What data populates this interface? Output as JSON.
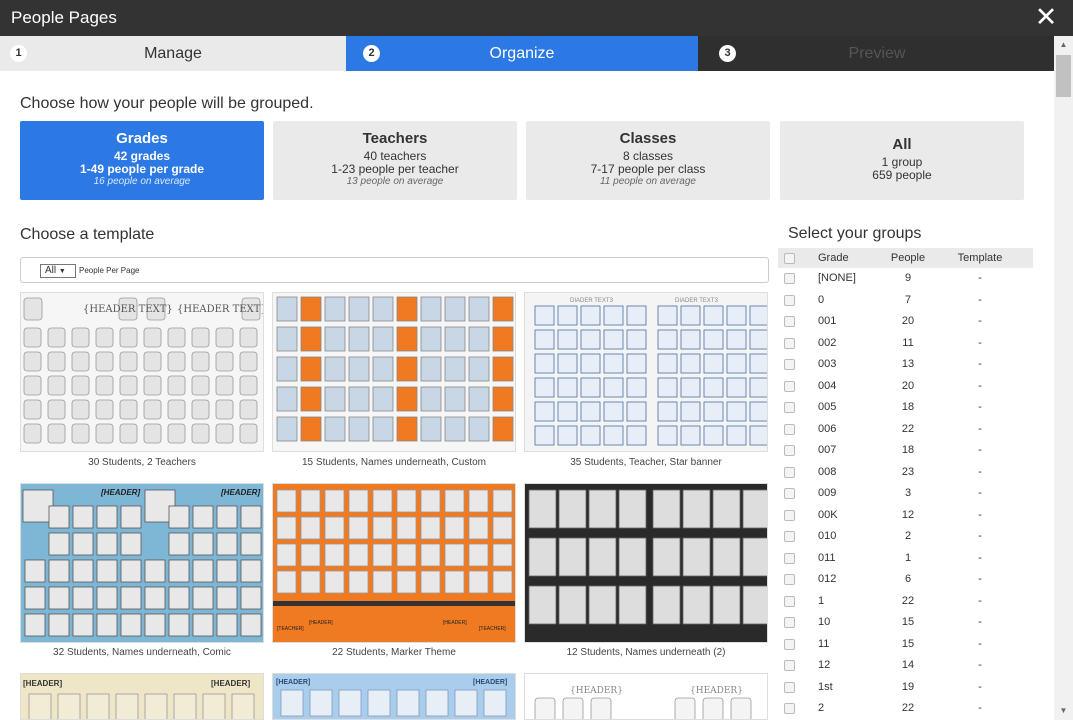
{
  "window": {
    "title": "People Pages",
    "close_icon": "close-icon"
  },
  "steps": [
    {
      "num": "1",
      "label": "Manage"
    },
    {
      "num": "2",
      "label": "Organize"
    },
    {
      "num": "3",
      "label": "Preview"
    }
  ],
  "grouping": {
    "heading": "Choose how your people will be grouped.",
    "options": [
      {
        "title": "Grades",
        "count": "42 grades",
        "range": "1-49 people per grade",
        "avg": "16 people on average"
      },
      {
        "title": "Teachers",
        "count": "40 teachers",
        "range": "1-23 people per teacher",
        "avg": "13 people on average"
      },
      {
        "title": "Classes",
        "count": "8 classes",
        "range": "7-17 people per class",
        "avg": "11 people on average"
      },
      {
        "title": "All",
        "count": "1 group",
        "range": "659 people"
      }
    ]
  },
  "templates": {
    "heading": "Choose a template",
    "filter_value": "All",
    "filter_label": "People Per Page",
    "items": [
      {
        "caption": "30 Students, 2 Teachers",
        "header_text": "{HEADER TEXT}"
      },
      {
        "caption": "15 Students, Names underneath, Custom"
      },
      {
        "caption": "35 Students, Teacher, Star banner",
        "header_text": "DIADER TEXT3"
      },
      {
        "caption": "32 Students, Names underneath, Comic",
        "header_text": "[HEADER]"
      },
      {
        "caption": "22 Students, Marker Theme",
        "header_text": "[HEADER]",
        "teacher_text": "[TEACHER]"
      },
      {
        "caption": "12 Students, Names underneath (2)"
      },
      {
        "caption": "",
        "header_text": "[HEADER]"
      },
      {
        "caption": "",
        "header_text": "[HEADER]"
      },
      {
        "caption": "",
        "header_text": "{HEADER}"
      }
    ]
  },
  "groups": {
    "heading": "Select your groups",
    "columns": [
      "Grade",
      "People",
      "Template"
    ],
    "rows": [
      {
        "grade": "[NONE]",
        "people": "9",
        "template": "-"
      },
      {
        "grade": "0",
        "people": "7",
        "template": "-"
      },
      {
        "grade": "001",
        "people": "20",
        "template": "-"
      },
      {
        "grade": "002",
        "people": "11",
        "template": "-"
      },
      {
        "grade": "003",
        "people": "13",
        "template": "-"
      },
      {
        "grade": "004",
        "people": "20",
        "template": "-"
      },
      {
        "grade": "005",
        "people": "18",
        "template": "-"
      },
      {
        "grade": "006",
        "people": "22",
        "template": "-"
      },
      {
        "grade": "007",
        "people": "18",
        "template": "-"
      },
      {
        "grade": "008",
        "people": "23",
        "template": "-"
      },
      {
        "grade": "009",
        "people": "3",
        "template": "-"
      },
      {
        "grade": "00K",
        "people": "12",
        "template": "-"
      },
      {
        "grade": "010",
        "people": "2",
        "template": "-"
      },
      {
        "grade": "011",
        "people": "1",
        "template": "-"
      },
      {
        "grade": "012",
        "people": "6",
        "template": "-"
      },
      {
        "grade": "1",
        "people": "22",
        "template": "-"
      },
      {
        "grade": "10",
        "people": "15",
        "template": "-"
      },
      {
        "grade": "11",
        "people": "15",
        "template": "-"
      },
      {
        "grade": "12",
        "people": "14",
        "template": "-"
      },
      {
        "grade": "1st",
        "people": "19",
        "template": "-"
      },
      {
        "grade": "2",
        "people": "22",
        "template": "-"
      }
    ]
  },
  "colors": {
    "accent": "#2c78e4",
    "titlebar": "#333333",
    "orange": "#f07a22",
    "comic_blue": "#7eb6d6",
    "dark": "#2a2a2a"
  }
}
